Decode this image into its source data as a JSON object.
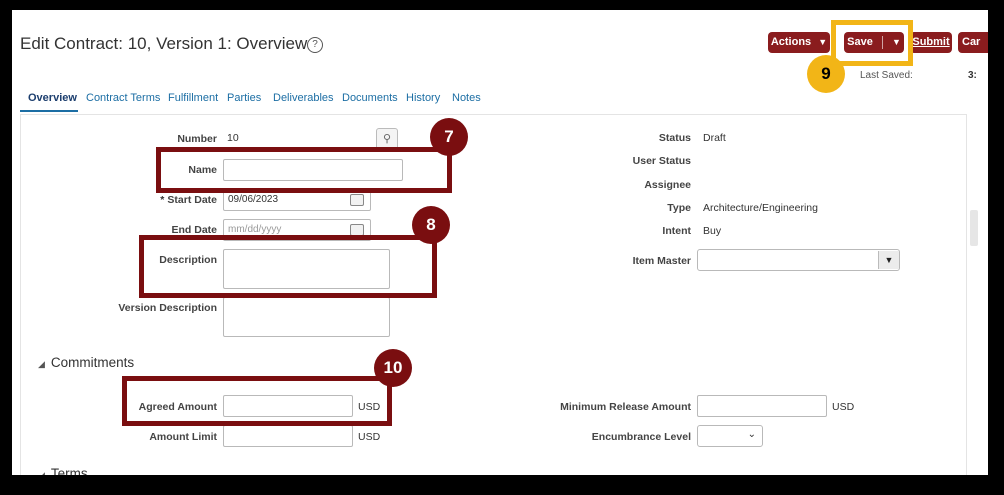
{
  "header": {
    "title": "Edit Contract: 10, Version 1: Overview",
    "actions_label": "Actions",
    "save_label": "Save",
    "submit_label": "Submit",
    "cancel_label": "Car",
    "last_saved_label": "Last Saved:",
    "last_saved_value": "3:"
  },
  "tabs": [
    "Overview",
    "Contract Terms",
    "Fulfillment",
    "Parties",
    "Deliverables",
    "Documents",
    "History",
    "Notes"
  ],
  "left_fields": {
    "number_label": "Number",
    "number_value": "10",
    "name_label": "Name",
    "name_value": "",
    "start_date_required": "*",
    "start_date_label": "Start Date",
    "start_date_value": "09/06/2023",
    "end_date_label": "End Date",
    "end_date_placeholder": "mm/dd/yyyy",
    "description_label": "Description",
    "version_description_label": "Version Description"
  },
  "right_fields": {
    "status_label": "Status",
    "status_value": "Draft",
    "user_status_label": "User Status",
    "assignee_label": "Assignee",
    "type_label": "Type",
    "type_value": "Architecture/Engineering",
    "intent_label": "Intent",
    "intent_value": "Buy",
    "item_master_label": "Item Master"
  },
  "commitments": {
    "section_title": "Commitments",
    "agreed_amount_label": "Agreed Amount",
    "amount_limit_label": "Amount Limit",
    "currency": "USD",
    "min_release_label": "Minimum Release Amount",
    "encumbrance_label": "Encumbrance Level"
  },
  "next_section_title": "Terms",
  "callouts": {
    "seven": "7",
    "eight": "8",
    "nine": "9",
    "ten": "10"
  },
  "colors": {
    "button_bg": "#8a1c1e",
    "callout_red": "#7a0e10",
    "callout_yellow": "#f2b517",
    "link_blue": "#1c6ea4"
  }
}
